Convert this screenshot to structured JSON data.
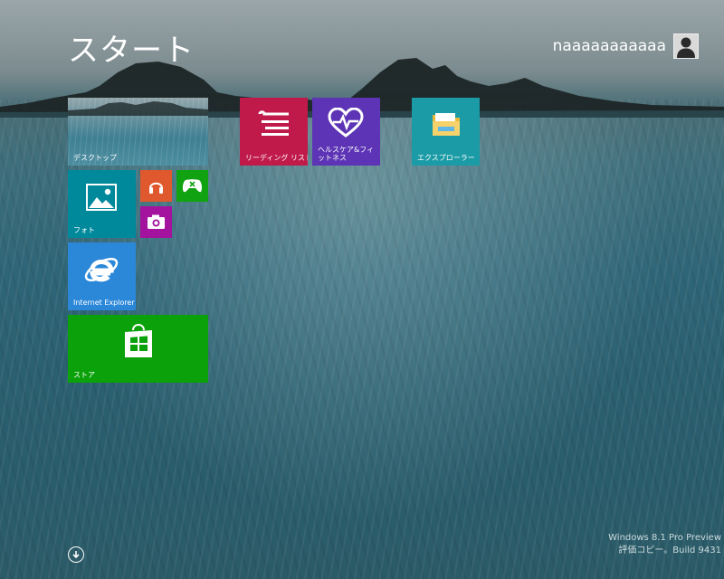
{
  "start": {
    "title": "スタート"
  },
  "user": {
    "name": "naaaaaaaaaaa",
    "avatar_icon": "user-silhouette-icon"
  },
  "tiles": {
    "desktop": {
      "label": "デスクトップ"
    },
    "photos": {
      "label": "フォト",
      "icon": "photos-icon"
    },
    "music": {
      "icon": "headphones-icon"
    },
    "games": {
      "icon": "xbox-controller-icon"
    },
    "camera": {
      "icon": "camera-icon"
    },
    "ie": {
      "label": "Internet Explorer",
      "icon": "internet-explorer-icon"
    },
    "store": {
      "label": "ストア",
      "icon": "store-bag-icon"
    },
    "reading": {
      "label": "リーディング リスト",
      "icon": "reading-list-icon"
    },
    "health": {
      "label": "ヘルスケア&フィットネス",
      "icon": "heart-pulse-icon"
    },
    "explorer": {
      "label": "エクスプローラー",
      "icon": "folder-icon"
    }
  },
  "colors": {
    "music": "#e0582e",
    "games": "#11a211",
    "camera": "#a3139e",
    "ie": "#2b88d8",
    "store": "#0aa10a",
    "reading": "#c01a4b",
    "health": "#5d34b5",
    "explorer": "#1a9ba6",
    "photos": "#00889b"
  },
  "footer": {
    "apps_icon": "down-arrow-circle-icon",
    "watermark_line1": "Windows 8.1 Pro Preview",
    "watermark_line2": "評価コピー。Build 9431"
  }
}
